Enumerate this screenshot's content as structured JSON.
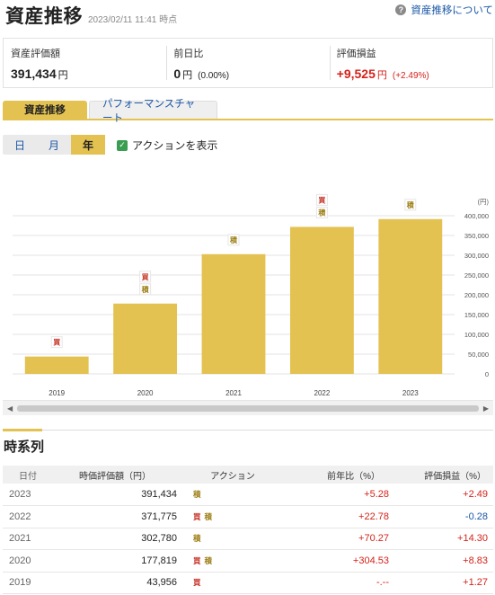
{
  "header": {
    "title": "資産推移",
    "timestamp": "2023/02/11 11:41 時点",
    "help_link": "資産推移について",
    "help_icon": "question-icon"
  },
  "summary": {
    "asset_label": "資産評価額",
    "asset_value": "391,434",
    "asset_unit": "円",
    "prev_label": "前日比",
    "prev_value": "0",
    "prev_unit": "円",
    "prev_pct": "(0.00%)",
    "pl_label": "評価損益",
    "pl_value": "+9,525",
    "pl_unit": "円",
    "pl_pct": "(+2.49%)"
  },
  "tabs": [
    {
      "label": "資産推移",
      "active": true
    },
    {
      "label": "パフォーマンスチャート",
      "active": false
    }
  ],
  "period": {
    "day": "日",
    "month": "月",
    "year": "年",
    "selected": "year"
  },
  "action_checkbox": {
    "label": "アクションを表示",
    "checked": true
  },
  "chart_data": {
    "type": "bar",
    "categories": [
      "2019",
      "2020",
      "2021",
      "2022",
      "2023"
    ],
    "values": [
      43956,
      177819,
      302780,
      371775,
      391434
    ],
    "ylabel": "(円)",
    "ylim": [
      0,
      400000
    ],
    "yticks": [
      "0",
      "50,000",
      "100,000",
      "150,000",
      "200,000",
      "250,000",
      "300,000",
      "350,000",
      "400,000"
    ],
    "grid": true,
    "bar_color": "#e3c251",
    "markers": [
      [
        "買"
      ],
      [
        "買",
        "積"
      ],
      [
        "積"
      ],
      [
        "買",
        "積"
      ],
      [
        "積"
      ]
    ]
  },
  "timeseries": {
    "title": "時系列",
    "headers": [
      "日付",
      "時価評価額（円）",
      "アクション",
      "前年比（%）",
      "評価損益（%）"
    ],
    "rows": [
      {
        "date": "2023",
        "value": "391,434",
        "actions": [
          "積"
        ],
        "yoy": "+5.28",
        "pl": "+2.49",
        "pl_sign": "pos"
      },
      {
        "date": "2022",
        "value": "371,775",
        "actions": [
          "買",
          "積"
        ],
        "yoy": "+22.78",
        "pl": "-0.28",
        "pl_sign": "neg"
      },
      {
        "date": "2021",
        "value": "302,780",
        "actions": [
          "積"
        ],
        "yoy": "+70.27",
        "pl": "+14.30",
        "pl_sign": "pos"
      },
      {
        "date": "2020",
        "value": "177,819",
        "actions": [
          "買",
          "積"
        ],
        "yoy": "+304.53",
        "pl": "+8.83",
        "pl_sign": "pos"
      },
      {
        "date": "2019",
        "value": "43,956",
        "actions": [
          "買"
        ],
        "yoy": "-.--",
        "pl": "+1.27",
        "pl_sign": "pos"
      }
    ]
  },
  "colors": {
    "accent": "#e3c251",
    "positive": "#d3231b",
    "negative": "#1a57a6",
    "link": "#1a57a6"
  }
}
